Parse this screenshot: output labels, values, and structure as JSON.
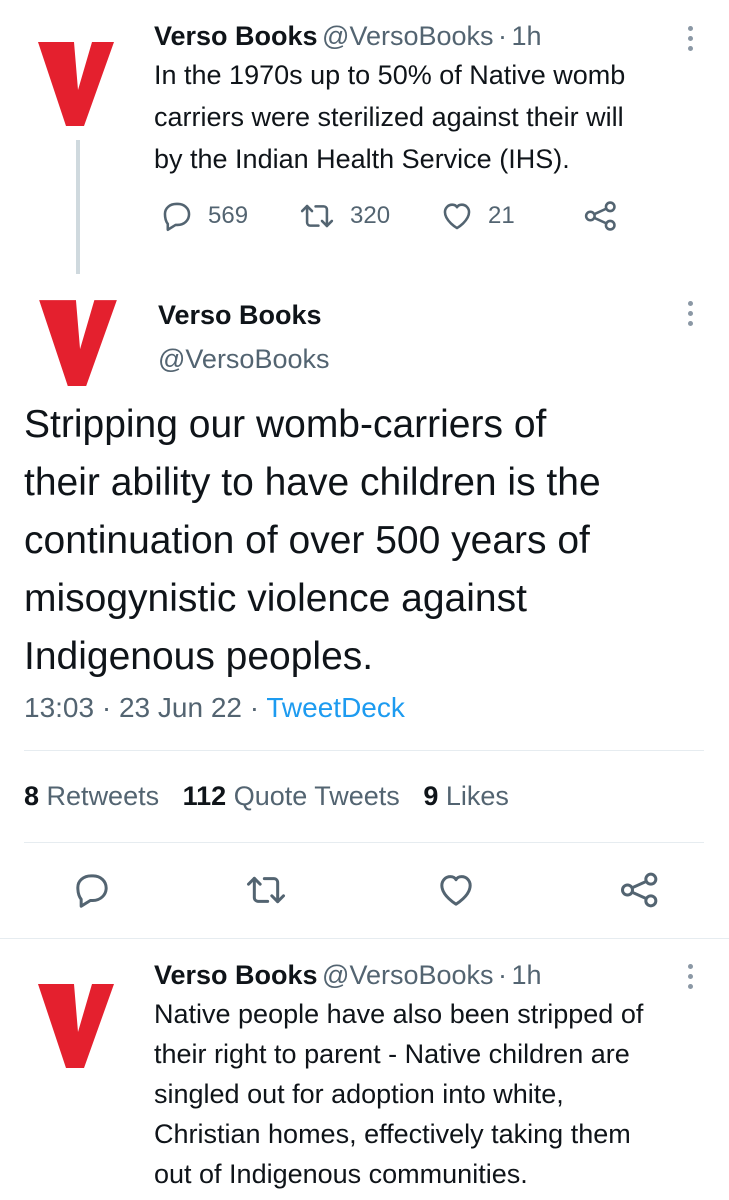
{
  "tweet_prev": {
    "name": "Verso Books",
    "handle": "@VersoBooks",
    "sep": "·",
    "time": "1h",
    "text_lines": [
      "In the 1970s up to 50% of Native womb",
      "carriers were sterilized against their will",
      "by the Indian Health Service (IHS)."
    ],
    "reply_count": "569",
    "retweet_count": "320",
    "like_count": "21"
  },
  "tweet_main": {
    "name": "Verso Books",
    "handle": "@VersoBooks",
    "text_lines": [
      "Stripping our womb-carriers of",
      "their ability to have children is the",
      "continuation of over 500 years of",
      "misogynistic violence against",
      "Indigenous peoples."
    ],
    "time": "13:03",
    "date": "23 Jun 22",
    "sep": "·",
    "source": "TweetDeck",
    "retweets_count": "8",
    "retweets_label": "Retweets",
    "quote_count": "112",
    "quote_label": "Quote Tweets",
    "likes_count": "9",
    "likes_label": "Likes"
  },
  "tweet_next": {
    "name": "Verso Books",
    "handle": "@VersoBooks",
    "sep": "·",
    "time": "1h",
    "text_lines": [
      "Native people have also been stripped of",
      "their right to parent - Native children are",
      "singled out for adoption into white,",
      "Christian homes, effectively taking them",
      "out of Indigenous communities."
    ]
  },
  "colors": {
    "brand_red": "#e4202e",
    "text": "#0f1419",
    "muted": "#536471",
    "link": "#1d9bf0"
  },
  "icons": [
    "verso-logo",
    "more-icon",
    "reply-icon",
    "retweet-icon",
    "like-icon",
    "share-icon"
  ]
}
